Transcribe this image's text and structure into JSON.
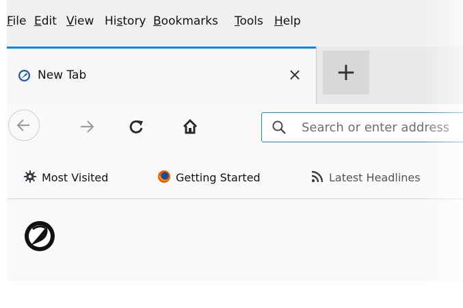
{
  "menu": {
    "items": [
      {
        "key": "F",
        "rest": "ile"
      },
      {
        "key": "E",
        "rest": "dit"
      },
      {
        "key": "V",
        "rest": "iew"
      },
      {
        "key": "s",
        "pre": "Hi",
        "rest": "tory"
      },
      {
        "key": "B",
        "rest": "ookmarks"
      },
      {
        "key": "T",
        "rest": "ools"
      },
      {
        "key": "H",
        "rest": "elp"
      }
    ]
  },
  "tabs": {
    "active": {
      "title": "New Tab",
      "close_glyph": "×"
    },
    "new_tab_glyph": "+"
  },
  "navbar": {
    "search_placeholder": "Search or enter address"
  },
  "bookmarks": {
    "items": [
      {
        "label": "Most Visited",
        "icon": "gear-icon"
      },
      {
        "label": "Getting Started",
        "icon": "firefox-icon"
      },
      {
        "label": "Latest Headlines",
        "icon": "rss-icon"
      }
    ]
  },
  "colors": {
    "accent": "#0a84ff",
    "toolbar_bg": "#f9f9fa",
    "menubar_bg": "#f0f0f0"
  }
}
